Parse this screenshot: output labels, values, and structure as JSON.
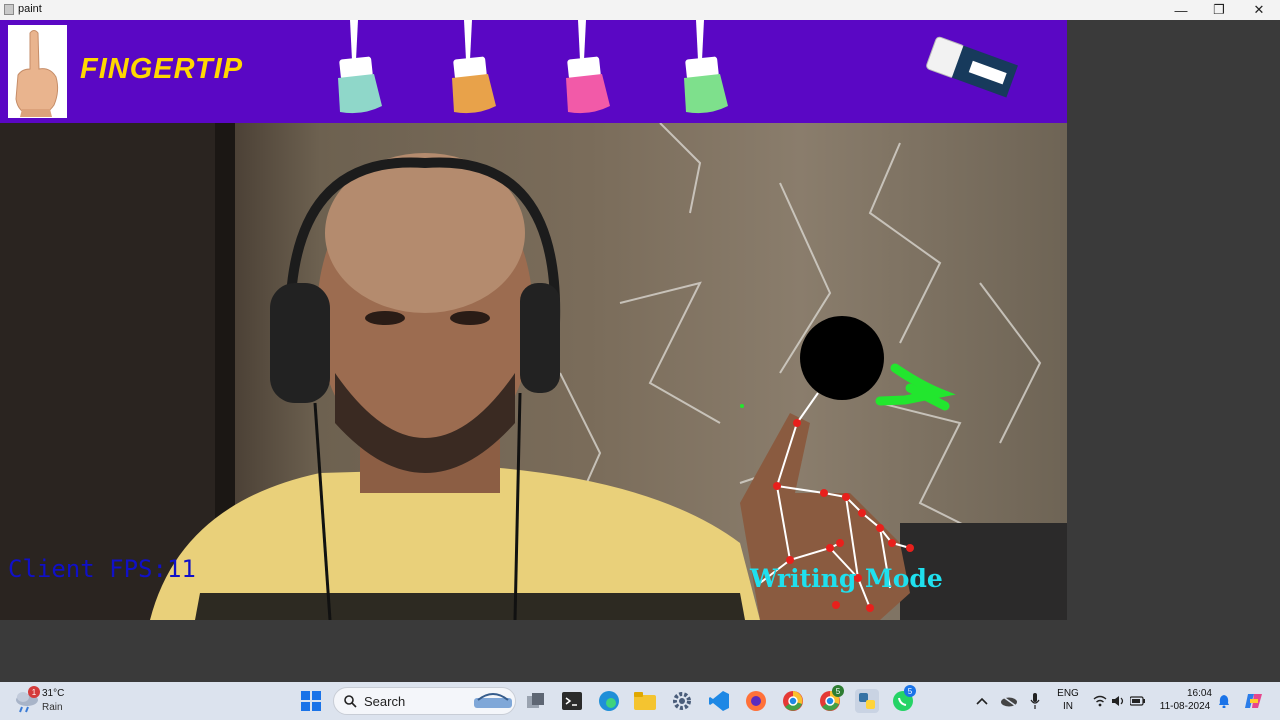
{
  "window": {
    "title": "paint",
    "minimize": "—",
    "maximize": "❐",
    "close": "✕"
  },
  "toolbar": {
    "brand": "FINGERTIP",
    "brushes": [
      {
        "name": "teal",
        "color": "#8fd7c9"
      },
      {
        "name": "orange",
        "color": "#e8a24a"
      },
      {
        "name": "pink",
        "color": "#f25aa8"
      },
      {
        "name": "green",
        "color": "#7ee08c"
      }
    ],
    "eraser": "eraser"
  },
  "feed": {
    "fps_text": "Client FPS:11",
    "mode_text": "Writing Mode"
  },
  "taskbar": {
    "weather_temp": "31°C",
    "weather_cond": "Rain",
    "weather_badge": "1",
    "search_label": "Search",
    "lang_top": "ENG",
    "lang_bottom": "IN",
    "time": "16:04",
    "date": "11-08-2024",
    "whatsapp_badge": "5",
    "chrome_badge": "5"
  },
  "colors": {
    "toolbar_bg": "#5a07c4",
    "brand": "#ffd800",
    "fps_text": "#1010c8",
    "mode_text": "#1fe0ee",
    "drawing": "#22e62e",
    "landmark": "#e8201c"
  }
}
